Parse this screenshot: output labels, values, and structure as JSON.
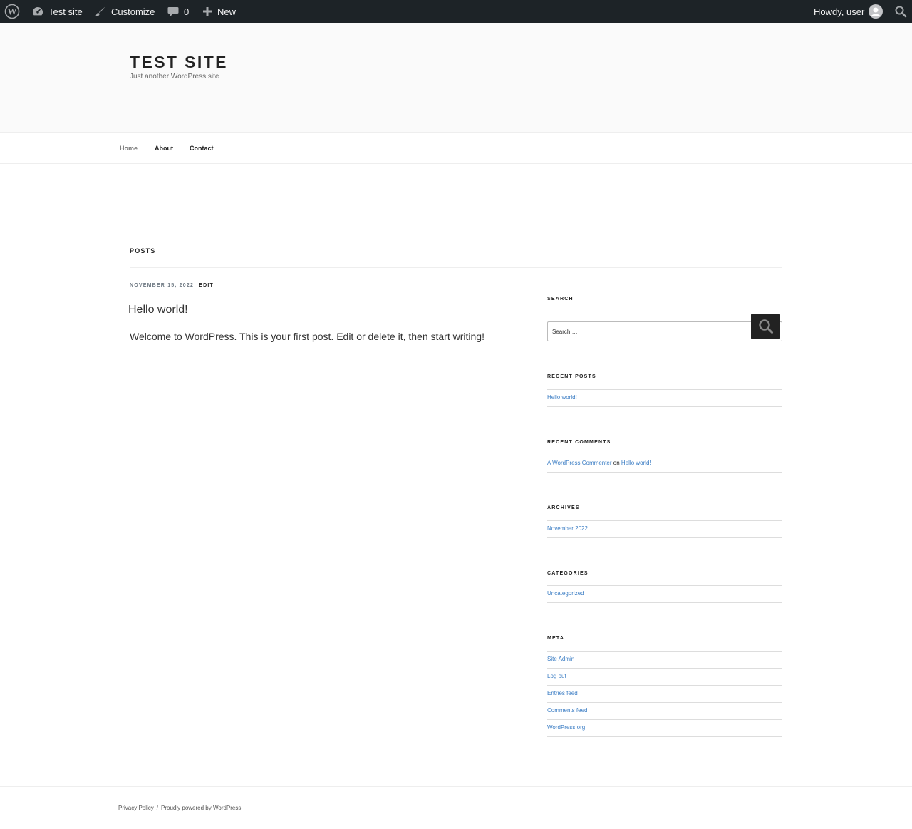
{
  "adminbar": {
    "wp_logo": "wordpress-icon",
    "site_name": "Test site",
    "customize": "Customize",
    "comments_count": "0",
    "new": "New",
    "howdy": "Howdy, user",
    "background_color": "#1d2327"
  },
  "header": {
    "title": "TEST SITE",
    "description": "Just another WordPress site"
  },
  "nav": {
    "items": [
      {
        "label": "Home",
        "current": true
      },
      {
        "label": "About"
      },
      {
        "label": "Contact"
      }
    ]
  },
  "page": {
    "title": "POSTS"
  },
  "post": {
    "date": "NOVEMBER 15, 2022",
    "edit": "EDIT",
    "title": "Hello world!",
    "content": "Welcome to WordPress. This is your first post. Edit or delete it, then start writing!"
  },
  "sidebar": {
    "search": {
      "title": "SEARCH",
      "placeholder": "Search …"
    },
    "recent_posts": {
      "title": "RECENT POSTS",
      "items": [
        "Hello world!"
      ]
    },
    "recent_comments": {
      "title": "RECENT COMMENTS",
      "author": "A WordPress Commenter",
      "on": "on",
      "post": "Hello world!"
    },
    "archives": {
      "title": "ARCHIVES",
      "items": [
        "November 2022"
      ]
    },
    "categories": {
      "title": "CATEGORIES",
      "items": [
        "Uncategorized"
      ]
    },
    "meta": {
      "title": "META",
      "items": [
        "Site Admin",
        "Log out",
        "Entries feed",
        "Comments feed",
        "WordPress.org"
      ]
    }
  },
  "footer": {
    "privacy": "Privacy Policy",
    "separator": "/",
    "powered": "Proudly powered by WordPress"
  },
  "colors": {
    "link": "#3b7dc4",
    "text": "#222222",
    "header_bg": "#fafafa"
  }
}
